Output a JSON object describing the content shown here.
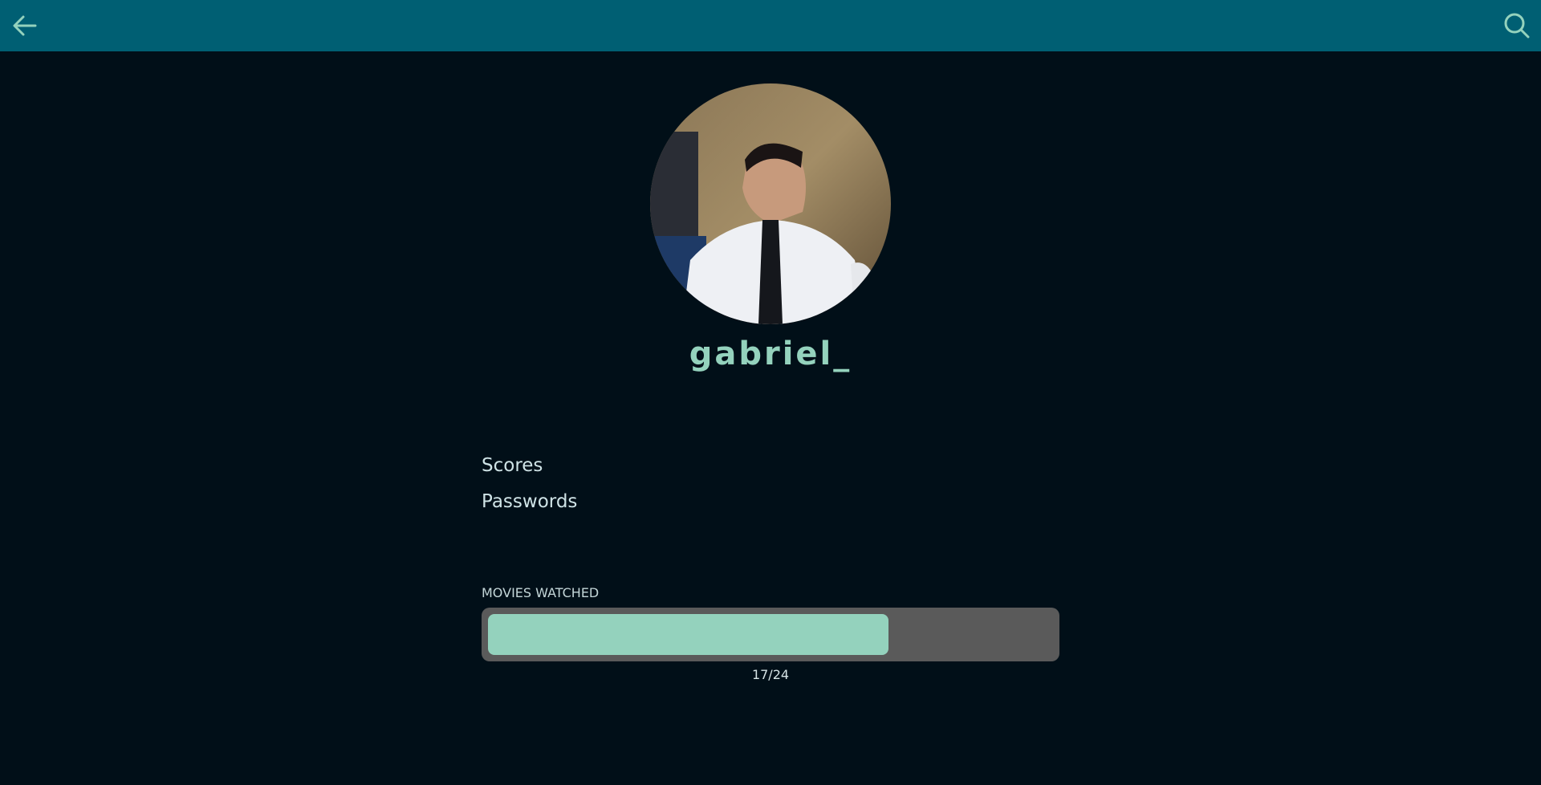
{
  "header": {
    "back_icon": "arrow-left-icon",
    "search_icon": "search-icon",
    "background_color": "#005f73",
    "icon_color": "#94d2bd"
  },
  "profile": {
    "avatar_alt": "gabriel_",
    "username": "gabriel_",
    "username_color": "#94d2bd"
  },
  "menu": {
    "items": [
      {
        "label": "Scores"
      },
      {
        "label": "Passwords"
      }
    ]
  },
  "progress": {
    "label": "MOVIES WATCHED",
    "watched": 17,
    "total": 24,
    "display": "17/24",
    "fill_color": "#94d2bd",
    "track_color": "#5a5a5a"
  }
}
